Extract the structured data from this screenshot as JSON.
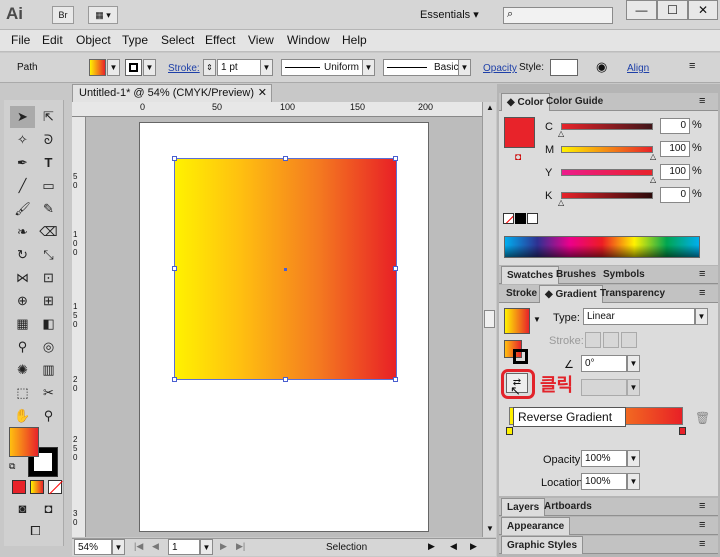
{
  "app": {
    "logo": "Ai",
    "bridge_label": "Br",
    "workspace": "Essentials"
  },
  "menu": [
    "File",
    "Edit",
    "Object",
    "Type",
    "Select",
    "Effect",
    "View",
    "Window",
    "Help"
  ],
  "control": {
    "selection_label": "Path",
    "stroke_label": "Stroke:",
    "stroke_weight": "1 pt",
    "profile_label": "Uniform",
    "brush_label": "Basic",
    "opacity_label": "Opacity",
    "style_label": "Style:",
    "align_label": "Align"
  },
  "document": {
    "tab_title": "Untitled-1* @ 54% (CMYK/Preview)",
    "zoom": "54%",
    "page": "1",
    "status": "Selection",
    "ruler_top": [
      "0",
      "50",
      "100",
      "150",
      "200"
    ],
    "ruler_left": [
      "5 0",
      "1 0 0",
      "1 5 0",
      "2 0",
      "2 5 0",
      "3 0"
    ]
  },
  "color_panel": {
    "tab_color": "Color",
    "tab_guide": "Color Guide",
    "channels": [
      {
        "name": "C",
        "value": "0"
      },
      {
        "name": "M",
        "value": "100"
      },
      {
        "name": "Y",
        "value": "100"
      },
      {
        "name": "K",
        "value": "0"
      }
    ],
    "swatch_color": "#e8232a"
  },
  "swatch_tabs": {
    "swatches": "Swatches",
    "brushes": "Brushes",
    "symbols": "Symbols"
  },
  "gradient_panel": {
    "tab_stroke": "Stroke",
    "tab_gradient": "Gradient",
    "tab_transparency": "Transparency",
    "type_label": "Type:",
    "type_value": "Linear",
    "stroke_label": "Stroke:",
    "angle_value": "0°",
    "opacity_label": "Opacity:",
    "opacity_value": "100%",
    "location_label": "Location:",
    "location_value": "100%"
  },
  "tooltip": "Reverse Gradient",
  "annotation": "클릭",
  "bottom_panels": {
    "layers": "Layers",
    "artboards": "Artboards",
    "appearance": "Appearance",
    "graphic_styles": "Graphic Styles"
  }
}
